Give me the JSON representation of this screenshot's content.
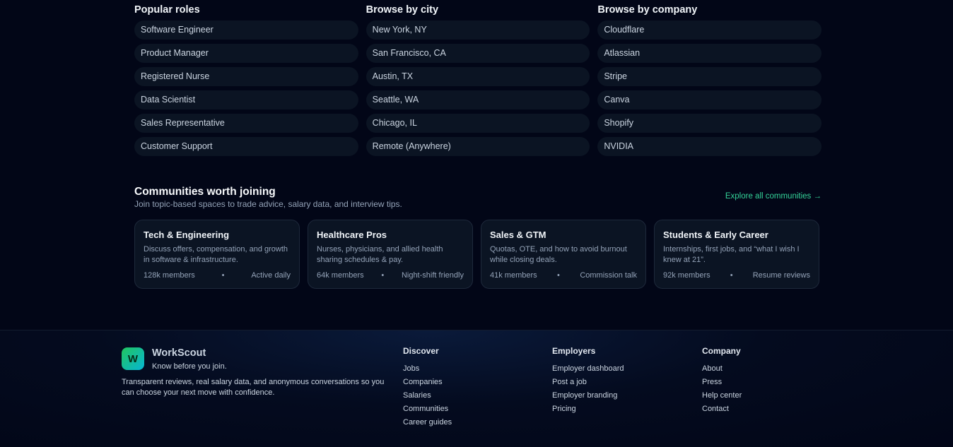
{
  "browse": {
    "roles": {
      "title": "Popular roles",
      "items": [
        "Software Engineer",
        "Product Manager",
        "Registered Nurse",
        "Data Scientist",
        "Sales Representative",
        "Customer Support"
      ]
    },
    "cities": {
      "title": "Browse by city",
      "items": [
        "New York, NY",
        "San Francisco, CA",
        "Austin, TX",
        "Seattle, WA",
        "Chicago, IL",
        "Remote (Anywhere)"
      ]
    },
    "companies": {
      "title": "Browse by company",
      "items": [
        "Cloudflare",
        "Atlassian",
        "Stripe",
        "Canva",
        "Shopify",
        "NVIDIA"
      ]
    }
  },
  "communities": {
    "title": "Communities worth joining",
    "subtitle": "Join topic-based spaces to trade advice, salary data, and interview tips.",
    "explore_label": "Explore all communities →",
    "cards": [
      {
        "title": "Tech & Engineering",
        "desc": "Discuss offers, compensation, and growth in software & infrastructure.",
        "members": "128k members",
        "sep": "•",
        "tag": "Active daily"
      },
      {
        "title": "Healthcare Pros",
        "desc": "Nurses, physicians, and allied health sharing schedules & pay.",
        "members": "64k members",
        "sep": "•",
        "tag": "Night-shift friendly"
      },
      {
        "title": "Sales & GTM",
        "desc": "Quotas, OTE, and how to avoid burnout while closing deals.",
        "members": "41k members",
        "sep": "•",
        "tag": "Commission talk"
      },
      {
        "title": "Students & Early Career",
        "desc": "Internships, first jobs, and “what I wish I knew at 21”.",
        "members": "92k members",
        "sep": "•",
        "tag": "Resume reviews"
      }
    ]
  },
  "footer": {
    "logo_letter": "W",
    "brand_name": "WorkScout",
    "tagline": "Know before you join.",
    "description": "Transparent reviews, real salary data, and anonymous conversations so you can choose your next move with confidence.",
    "discover": {
      "title": "Discover",
      "links": [
        "Jobs",
        "Companies",
        "Salaries",
        "Communities",
        "Career guides"
      ]
    },
    "employers": {
      "title": "Employers",
      "links": [
        "Employer dashboard",
        "Post a job",
        "Employer branding",
        "Pricing"
      ]
    },
    "company": {
      "title": "Company",
      "links": [
        "About",
        "Press",
        "Help center",
        "Contact"
      ]
    }
  },
  "colors": {
    "background": "#020617",
    "accent": "#34d399",
    "card": "#0b1423"
  }
}
